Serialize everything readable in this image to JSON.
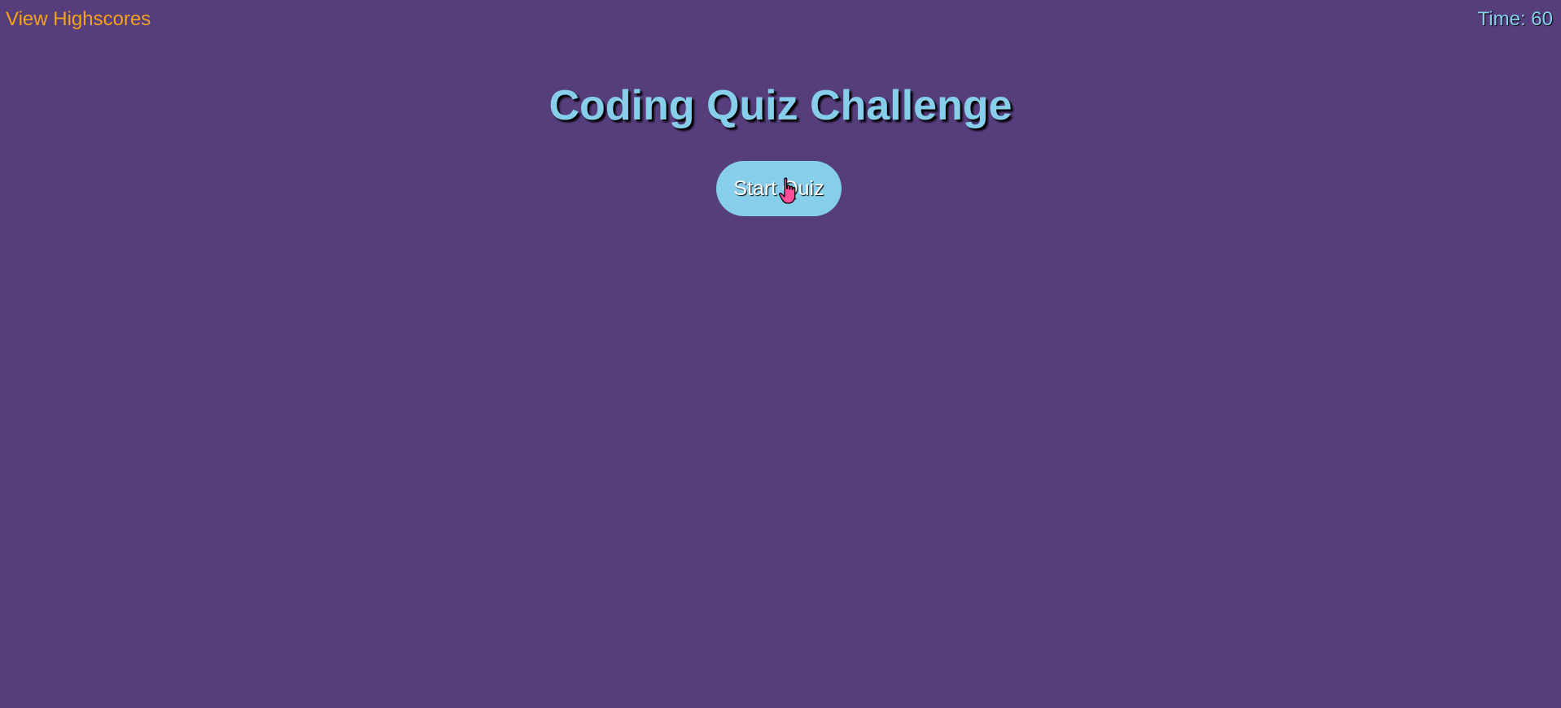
{
  "header": {
    "highscores_label": "View Highscores",
    "timer_label": "Time: 60"
  },
  "main": {
    "title": "Coding Quiz Challenge",
    "start_button_label": "Start Quiz"
  },
  "colors": {
    "background": "#563d7c",
    "accent": "#87ceeb",
    "link": "#f5a11a"
  },
  "icons": {
    "cursor": "hand-pointer-icon"
  }
}
